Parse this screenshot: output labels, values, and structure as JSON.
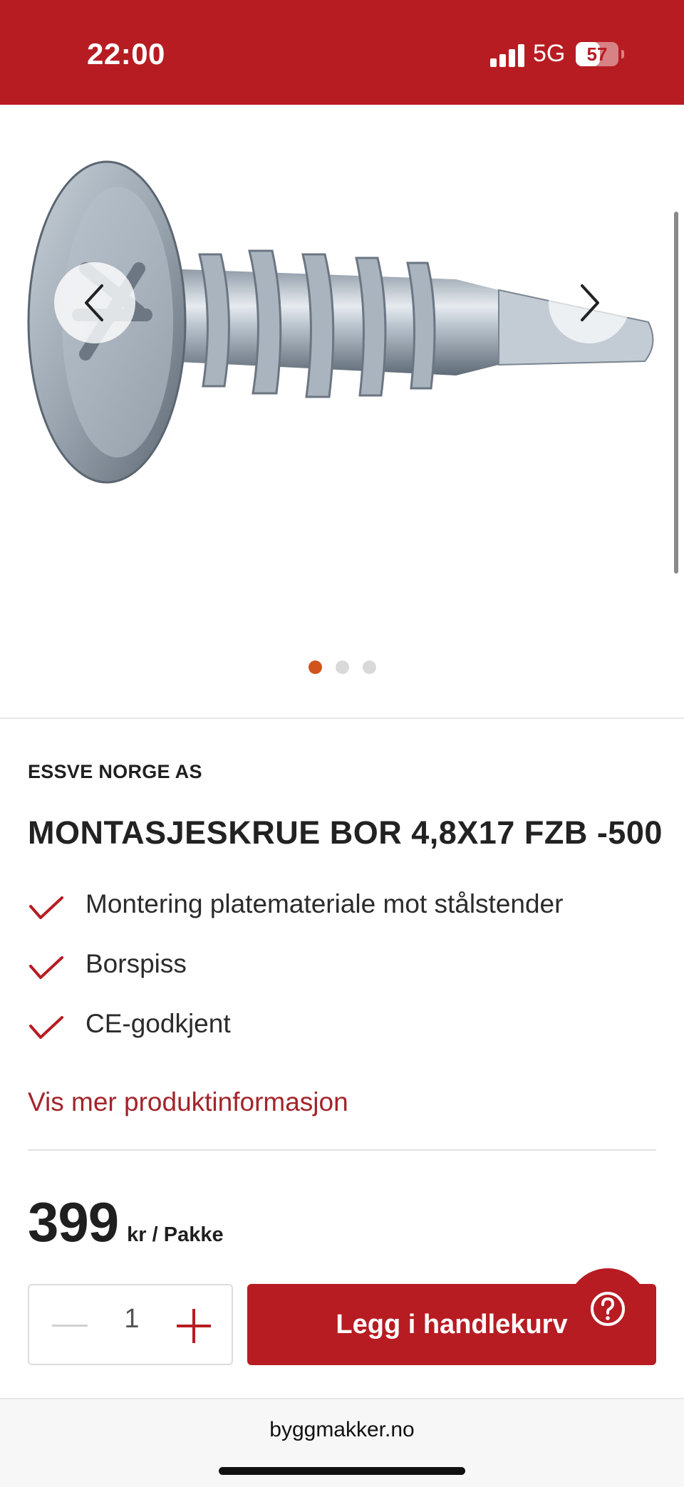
{
  "status_bar": {
    "time": "22:00",
    "network": "5G",
    "battery": "57",
    "battery_level": 0.57
  },
  "gallery": {
    "image_alt": "Montasjeskrue bor 4,8x17 FZB",
    "slide_count": 3,
    "active_slide": 1
  },
  "product": {
    "brand": "ESSVE NORGE AS",
    "title": "MONTASJESKRUE BOR 4,8X17 FZB -500",
    "features": [
      "Montering platemateriale mot stålstender",
      "Borspiss",
      "CE-godkjent"
    ],
    "more_info_link": "Vis mer produktinformasjon"
  },
  "price": {
    "value": "399",
    "unit": "kr / Pakke"
  },
  "cart": {
    "quantity": "1",
    "add_label": "Legg i handlekurv"
  },
  "browser": {
    "url": "byggmakker.no"
  },
  "colors": {
    "brand_red": "#b71c22",
    "link_red": "#a3242a",
    "active_dot": "#d2541d"
  },
  "icons": {
    "prev": "chevron-left-icon",
    "next": "chevron-right-icon",
    "check": "check-icon",
    "minus": "minus-icon",
    "plus": "plus-icon",
    "help": "question-mark-icon"
  }
}
